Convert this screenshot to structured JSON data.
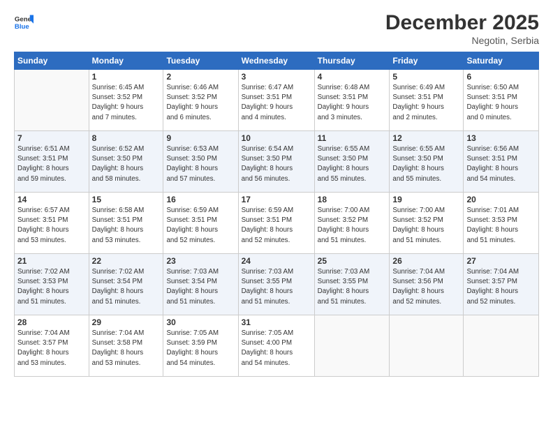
{
  "logo": {
    "line1": "General",
    "line2": "Blue"
  },
  "title": "December 2025",
  "location": "Negotin, Serbia",
  "days_of_week": [
    "Sunday",
    "Monday",
    "Tuesday",
    "Wednesday",
    "Thursday",
    "Friday",
    "Saturday"
  ],
  "weeks": [
    [
      {
        "day": "",
        "info": ""
      },
      {
        "day": "1",
        "info": "Sunrise: 6:45 AM\nSunset: 3:52 PM\nDaylight: 9 hours\nand 7 minutes."
      },
      {
        "day": "2",
        "info": "Sunrise: 6:46 AM\nSunset: 3:52 PM\nDaylight: 9 hours\nand 6 minutes."
      },
      {
        "day": "3",
        "info": "Sunrise: 6:47 AM\nSunset: 3:51 PM\nDaylight: 9 hours\nand 4 minutes."
      },
      {
        "day": "4",
        "info": "Sunrise: 6:48 AM\nSunset: 3:51 PM\nDaylight: 9 hours\nand 3 minutes."
      },
      {
        "day": "5",
        "info": "Sunrise: 6:49 AM\nSunset: 3:51 PM\nDaylight: 9 hours\nand 2 minutes."
      },
      {
        "day": "6",
        "info": "Sunrise: 6:50 AM\nSunset: 3:51 PM\nDaylight: 9 hours\nand 0 minutes."
      }
    ],
    [
      {
        "day": "7",
        "info": "Sunrise: 6:51 AM\nSunset: 3:51 PM\nDaylight: 8 hours\nand 59 minutes."
      },
      {
        "day": "8",
        "info": "Sunrise: 6:52 AM\nSunset: 3:50 PM\nDaylight: 8 hours\nand 58 minutes."
      },
      {
        "day": "9",
        "info": "Sunrise: 6:53 AM\nSunset: 3:50 PM\nDaylight: 8 hours\nand 57 minutes."
      },
      {
        "day": "10",
        "info": "Sunrise: 6:54 AM\nSunset: 3:50 PM\nDaylight: 8 hours\nand 56 minutes."
      },
      {
        "day": "11",
        "info": "Sunrise: 6:55 AM\nSunset: 3:50 PM\nDaylight: 8 hours\nand 55 minutes."
      },
      {
        "day": "12",
        "info": "Sunrise: 6:55 AM\nSunset: 3:50 PM\nDaylight: 8 hours\nand 55 minutes."
      },
      {
        "day": "13",
        "info": "Sunrise: 6:56 AM\nSunset: 3:51 PM\nDaylight: 8 hours\nand 54 minutes."
      }
    ],
    [
      {
        "day": "14",
        "info": "Sunrise: 6:57 AM\nSunset: 3:51 PM\nDaylight: 8 hours\nand 53 minutes."
      },
      {
        "day": "15",
        "info": "Sunrise: 6:58 AM\nSunset: 3:51 PM\nDaylight: 8 hours\nand 53 minutes."
      },
      {
        "day": "16",
        "info": "Sunrise: 6:59 AM\nSunset: 3:51 PM\nDaylight: 8 hours\nand 52 minutes."
      },
      {
        "day": "17",
        "info": "Sunrise: 6:59 AM\nSunset: 3:51 PM\nDaylight: 8 hours\nand 52 minutes."
      },
      {
        "day": "18",
        "info": "Sunrise: 7:00 AM\nSunset: 3:52 PM\nDaylight: 8 hours\nand 51 minutes."
      },
      {
        "day": "19",
        "info": "Sunrise: 7:00 AM\nSunset: 3:52 PM\nDaylight: 8 hours\nand 51 minutes."
      },
      {
        "day": "20",
        "info": "Sunrise: 7:01 AM\nSunset: 3:53 PM\nDaylight: 8 hours\nand 51 minutes."
      }
    ],
    [
      {
        "day": "21",
        "info": "Sunrise: 7:02 AM\nSunset: 3:53 PM\nDaylight: 8 hours\nand 51 minutes."
      },
      {
        "day": "22",
        "info": "Sunrise: 7:02 AM\nSunset: 3:54 PM\nDaylight: 8 hours\nand 51 minutes."
      },
      {
        "day": "23",
        "info": "Sunrise: 7:03 AM\nSunset: 3:54 PM\nDaylight: 8 hours\nand 51 minutes."
      },
      {
        "day": "24",
        "info": "Sunrise: 7:03 AM\nSunset: 3:55 PM\nDaylight: 8 hours\nand 51 minutes."
      },
      {
        "day": "25",
        "info": "Sunrise: 7:03 AM\nSunset: 3:55 PM\nDaylight: 8 hours\nand 51 minutes."
      },
      {
        "day": "26",
        "info": "Sunrise: 7:04 AM\nSunset: 3:56 PM\nDaylight: 8 hours\nand 52 minutes."
      },
      {
        "day": "27",
        "info": "Sunrise: 7:04 AM\nSunset: 3:57 PM\nDaylight: 8 hours\nand 52 minutes."
      }
    ],
    [
      {
        "day": "28",
        "info": "Sunrise: 7:04 AM\nSunset: 3:57 PM\nDaylight: 8 hours\nand 53 minutes."
      },
      {
        "day": "29",
        "info": "Sunrise: 7:04 AM\nSunset: 3:58 PM\nDaylight: 8 hours\nand 53 minutes."
      },
      {
        "day": "30",
        "info": "Sunrise: 7:05 AM\nSunset: 3:59 PM\nDaylight: 8 hours\nand 54 minutes."
      },
      {
        "day": "31",
        "info": "Sunrise: 7:05 AM\nSunset: 4:00 PM\nDaylight: 8 hours\nand 54 minutes."
      },
      {
        "day": "",
        "info": ""
      },
      {
        "day": "",
        "info": ""
      },
      {
        "day": "",
        "info": ""
      }
    ]
  ]
}
